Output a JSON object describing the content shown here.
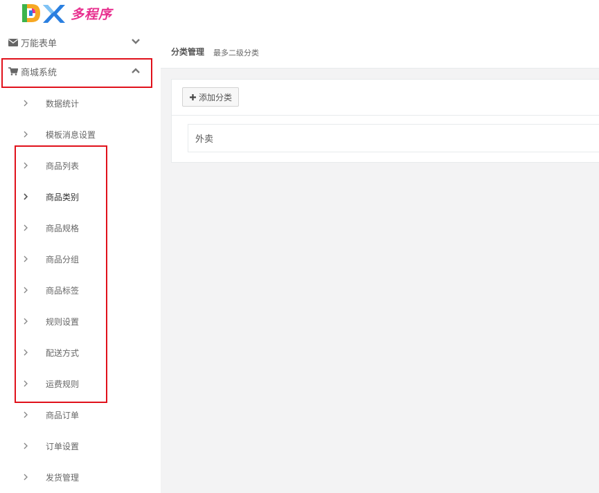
{
  "logo": {
    "mark_letters": "DX",
    "text": "多程序"
  },
  "sidebar": {
    "sections": [
      {
        "label": "万能表单",
        "icon": "envelope-icon",
        "chevron": "chevron-down-icon"
      },
      {
        "label": "商城系统",
        "icon": "cart-icon",
        "chevron": "chevron-up-icon"
      }
    ],
    "items": [
      {
        "label": "数据统计"
      },
      {
        "label": "模板消息设置"
      },
      {
        "label": "商品列表"
      },
      {
        "label": "商品类别"
      },
      {
        "label": "商品规格"
      },
      {
        "label": "商品分组"
      },
      {
        "label": "商品标签"
      },
      {
        "label": "规则设置"
      },
      {
        "label": "配送方式"
      },
      {
        "label": "运费规则"
      },
      {
        "label": "商品订单"
      },
      {
        "label": "订单设置"
      },
      {
        "label": "发货管理"
      }
    ]
  },
  "page": {
    "title": "分类管理",
    "subtitle": "最多二级分类"
  },
  "toolbar": {
    "add_label": "添加分类"
  },
  "categories": [
    {
      "label": "外卖"
    }
  ],
  "colors": {
    "highlight_box": "#e0101a",
    "logo_text": "#e8308f",
    "main_bg": "#f3f3f4"
  }
}
